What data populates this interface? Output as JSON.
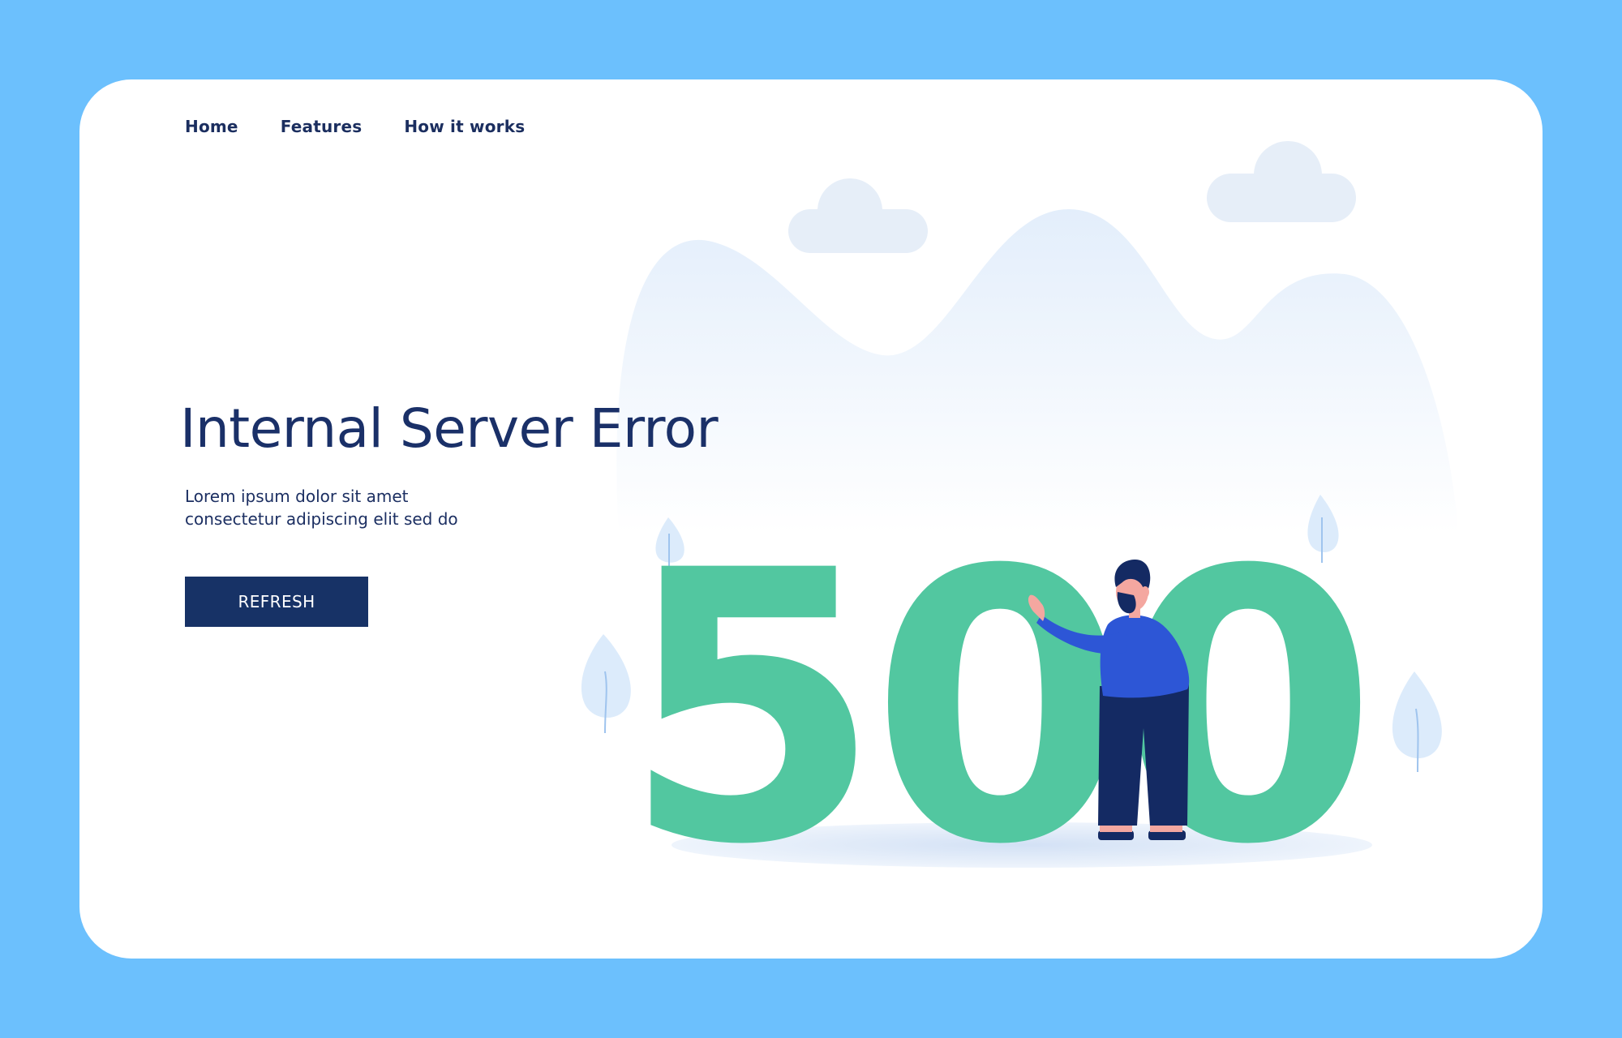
{
  "nav": {
    "items": [
      {
        "label": "Home"
      },
      {
        "label": "Features"
      },
      {
        "label": "How it works"
      }
    ]
  },
  "hero": {
    "title": "Internal Server Error",
    "description_line1": "Lorem ipsum dolor sit amet",
    "description_line2": "consectetur adipiscing elit sed do",
    "refresh_label": "REFRESH"
  },
  "illustration": {
    "error_code": "500",
    "number_color": "#52c7a0",
    "shirt_color": "#2d56d6",
    "pants_color": "#142a63",
    "hill_color": "#eaf3fd",
    "cloud_color": "#e6eef8",
    "tree_color": "#dcebfb"
  },
  "colors": {
    "background": "#6cc0fd",
    "card": "#ffffff",
    "primary": "#173266"
  }
}
